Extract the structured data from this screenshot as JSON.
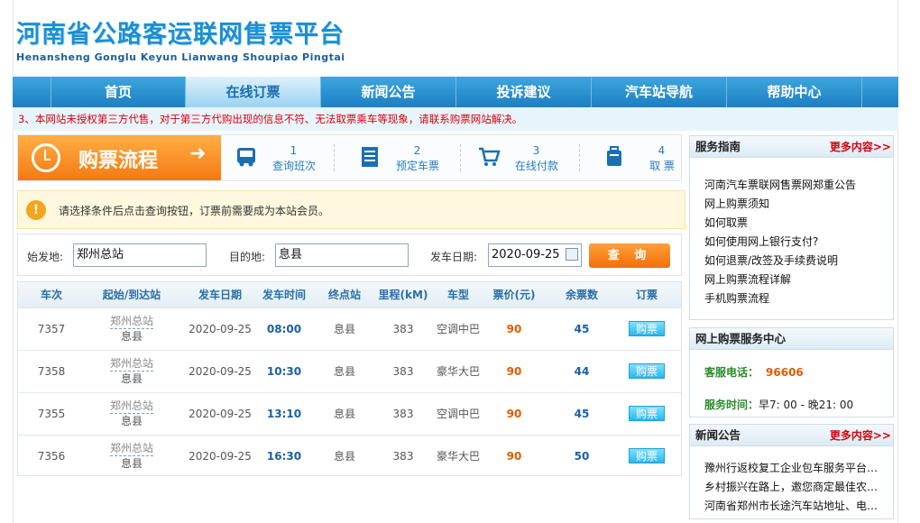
{
  "header": {
    "logo_cn": "河南省公路客运联网售票平台",
    "logo_en": "Henansheng Gonglu Keyun Lianwang Shoupiao Pingtai"
  },
  "nav": {
    "items": [
      {
        "label": "首页",
        "active": false
      },
      {
        "label": "在线订票",
        "active": true
      },
      {
        "label": "新闻公告",
        "active": false
      },
      {
        "label": "投诉建议",
        "active": false
      },
      {
        "label": "汽车站导航",
        "active": false
      },
      {
        "label": "帮助中心",
        "active": false
      }
    ]
  },
  "notice": "3、本网站未授权第三方代售，对于第三方代购出现的信息不符、无法取票乘车等现象，请联系购票网站解决。",
  "steps": {
    "lead_label": "购票流程",
    "lead_arrow": "➜",
    "items": [
      {
        "num": "1",
        "label": "查询班次",
        "icon": "bus-icon"
      },
      {
        "num": "2",
        "label": "预定车票",
        "icon": "document-icon"
      },
      {
        "num": "3",
        "label": "在线付款",
        "icon": "cart-icon"
      },
      {
        "num": "4",
        "label": "取  票",
        "icon": "luggage-icon"
      }
    ]
  },
  "tip": {
    "icon": "!",
    "text": "请选择条件后点击查询按钮，订票前需要成为本站会员。"
  },
  "search": {
    "from_label": "始发地:",
    "from_value": "郑州总站",
    "to_label": "目的地:",
    "to_value": "息县",
    "date_label": "发车日期:",
    "date_value": "2020-09-25",
    "query_label": "查 询"
  },
  "table": {
    "headers": [
      "车次",
      "起始/到达站",
      "发车日期",
      "发车时间",
      "终点站",
      "里程(kM)",
      "车型",
      "票价(元)",
      "余票数",
      "订票"
    ],
    "rows": [
      {
        "no": "7357",
        "from": "郑州总站",
        "to": "息县",
        "date": "2020-09-25",
        "time": "08:00",
        "end": "息县",
        "km": "383",
        "type": "空调中巴",
        "price": "90",
        "seats": "45",
        "buy": "购票"
      },
      {
        "no": "7358",
        "from": "郑州总站",
        "to": "息县",
        "date": "2020-09-25",
        "time": "10:30",
        "end": "息县",
        "km": "383",
        "type": "豪华大巴",
        "price": "90",
        "seats": "44",
        "buy": "购票"
      },
      {
        "no": "7355",
        "from": "郑州总站",
        "to": "息县",
        "date": "2020-09-25",
        "time": "13:10",
        "end": "息县",
        "km": "383",
        "type": "空调中巴",
        "price": "90",
        "seats": "45",
        "buy": "购票"
      },
      {
        "no": "7356",
        "from": "郑州总站",
        "to": "息县",
        "date": "2020-09-25",
        "time": "16:30",
        "end": "息县",
        "km": "383",
        "type": "豪华大巴",
        "price": "90",
        "seats": "50",
        "buy": "购票"
      }
    ]
  },
  "guide": {
    "title": "服务指南",
    "more": "更多内容>>",
    "items": [
      "河南汽车票联网售票网郑重公告",
      "网上购票须知",
      "如何取票",
      "如何使用网上银行支付?",
      "如何退票/改签及手续费说明",
      "网上购票流程详解",
      "手机购票流程"
    ]
  },
  "service": {
    "title": "网上购票服务中心",
    "phone_label": "客服电话：",
    "phone_value": "96606",
    "hours_label": "服务时间：",
    "hours_value": "早7: 00 - 晚21: 00"
  },
  "news": {
    "title": "新闻公告",
    "more": "更多内容>>",
    "items": [
      "豫州行返校复工企业包车服务平台…",
      "乡村振兴在路上，邀您商定最佳农…",
      "河南省郑州市长途汽车站地址、电…"
    ]
  }
}
